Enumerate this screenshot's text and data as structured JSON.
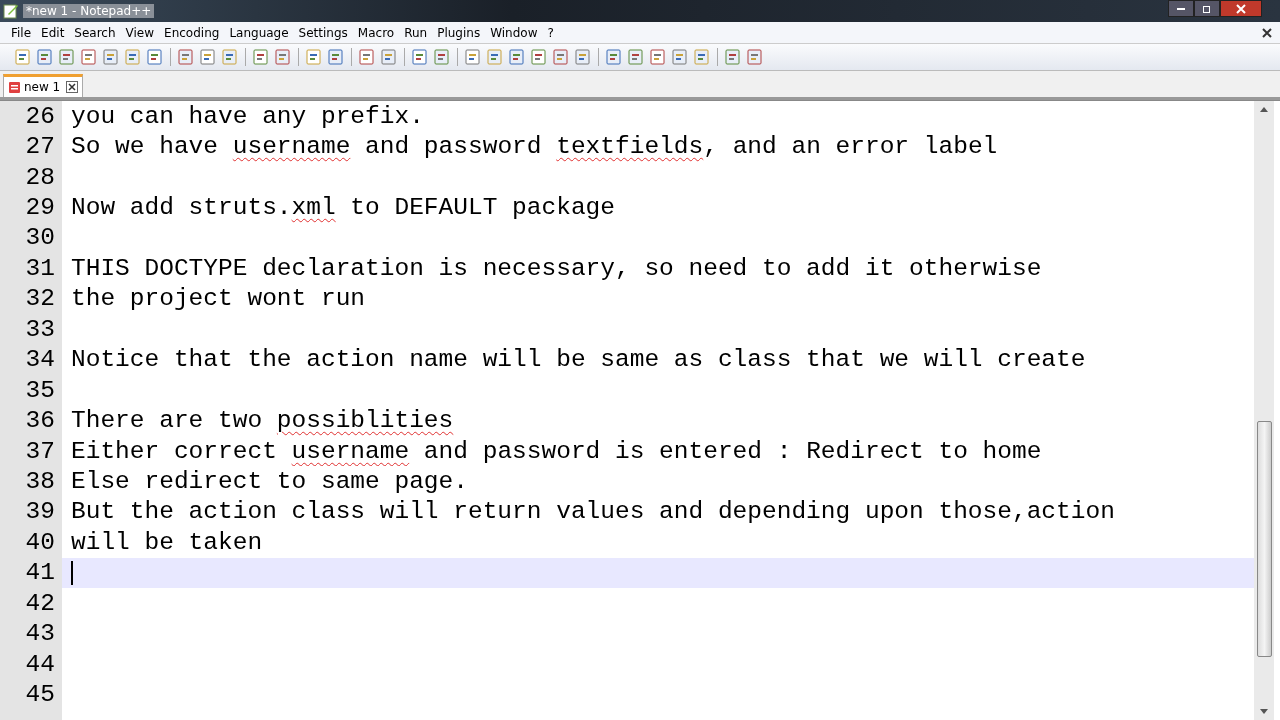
{
  "window": {
    "title": "*new 1 - Notepad++"
  },
  "menu": [
    "File",
    "Edit",
    "Search",
    "View",
    "Encoding",
    "Language",
    "Settings",
    "Macro",
    "Run",
    "Plugins",
    "Window",
    "?"
  ],
  "tabs": [
    {
      "label": "new 1",
      "selected": true,
      "modified": true
    }
  ],
  "editor": {
    "lines": [
      {
        "number": "26",
        "current": false,
        "segments": [
          {
            "text": "you can have any prefix.",
            "misspelled": false
          }
        ]
      },
      {
        "number": "27",
        "current": false,
        "segments": [
          {
            "text": "So we have ",
            "misspelled": false
          },
          {
            "text": "username",
            "misspelled": true
          },
          {
            "text": " and password ",
            "misspelled": false
          },
          {
            "text": "textfields",
            "misspelled": true
          },
          {
            "text": ", and an error label",
            "misspelled": false
          }
        ]
      },
      {
        "number": "28",
        "current": false
      },
      {
        "number": "29",
        "current": false,
        "segments": [
          {
            "text": "Now add struts.",
            "misspelled": false
          },
          {
            "text": "xml",
            "misspelled": true
          },
          {
            "text": " to DEFAULT package",
            "misspelled": false
          }
        ]
      },
      {
        "number": "30",
        "current": false
      },
      {
        "number": "31",
        "current": false,
        "segments": [
          {
            "text": "THIS DOCTYPE declaration is necessary, so need to add it otherwise",
            "misspelled": false
          }
        ]
      },
      {
        "number": "32",
        "current": false,
        "segments": [
          {
            "text": "the project wont run",
            "misspelled": false
          }
        ]
      },
      {
        "number": "33",
        "current": false
      },
      {
        "number": "34",
        "current": false,
        "segments": [
          {
            "text": "Notice that the action name will be same as class that we will create",
            "misspelled": false
          }
        ]
      },
      {
        "number": "35",
        "current": false
      },
      {
        "number": "36",
        "current": false,
        "segments": [
          {
            "text": "There are two ",
            "misspelled": false
          },
          {
            "text": "possiblities",
            "misspelled": true
          }
        ]
      },
      {
        "number": "37",
        "current": false,
        "segments": [
          {
            "text": "Either correct ",
            "misspelled": false
          },
          {
            "text": "username",
            "misspelled": true
          },
          {
            "text": " and password is entered : Redirect to home",
            "misspelled": false
          }
        ]
      },
      {
        "number": "38",
        "current": false,
        "segments": [
          {
            "text": "Else redirect to same page.",
            "misspelled": false
          }
        ]
      },
      {
        "number": "39",
        "current": false,
        "segments": [
          {
            "text": "But the action class will return values and depending upon those,action",
            "misspelled": false
          }
        ]
      },
      {
        "number": "40",
        "current": false,
        "segments": [
          {
            "text": "will be taken",
            "misspelled": false
          }
        ]
      },
      {
        "number": "41",
        "current": true
      },
      {
        "number": "42",
        "current": false
      },
      {
        "number": "43",
        "current": false
      },
      {
        "number": "44",
        "current": false
      },
      {
        "number": "45",
        "current": false
      }
    ]
  }
}
